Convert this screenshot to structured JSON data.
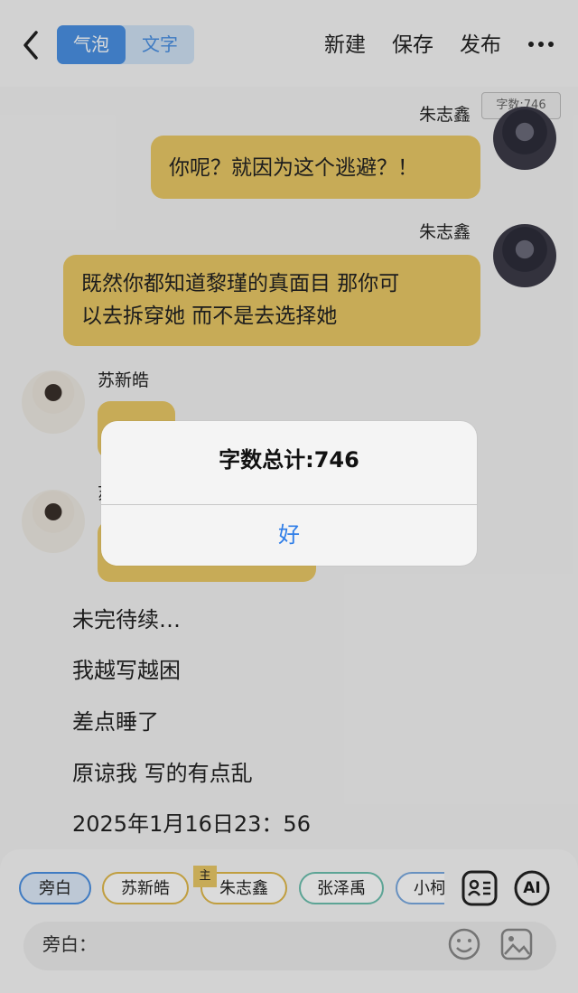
{
  "header": {
    "back_icon": "chevron-left-icon",
    "segment": {
      "selected": "气泡",
      "other": "文字"
    },
    "actions": {
      "new": "新建",
      "save": "保存",
      "publish": "发布"
    },
    "more_icon": "more-dots-icon"
  },
  "word_count_badge": "字数:746",
  "messages": [
    {
      "speaker": "朱志鑫",
      "text": "你呢？就因为这个逃避？！"
    },
    {
      "speaker": "朱志鑫",
      "text_line1": "既然你都知道黎瑾的真面目 那你可",
      "text_line2": "以去拆穿她 而不是去选择她"
    },
    {
      "speaker": "苏新皓"
    },
    {
      "speaker": "苏"
    }
  ],
  "narration": [
    "未完待续…",
    "我越写越困",
    "差点睡了",
    "原谅我 写的有点乱",
    "2025年1月16日23：56"
  ],
  "dialog": {
    "title": "字数总计:746",
    "ok": "好"
  },
  "bottom": {
    "chips": [
      "旁白",
      "苏新皓",
      "朱志鑫",
      "张泽禹",
      "小柯"
    ],
    "main_mark": "主",
    "ai_label": "AI",
    "input_label": "旁白：",
    "colors": {
      "accent": "#4a90e2",
      "bubble": "#e8c766"
    }
  }
}
